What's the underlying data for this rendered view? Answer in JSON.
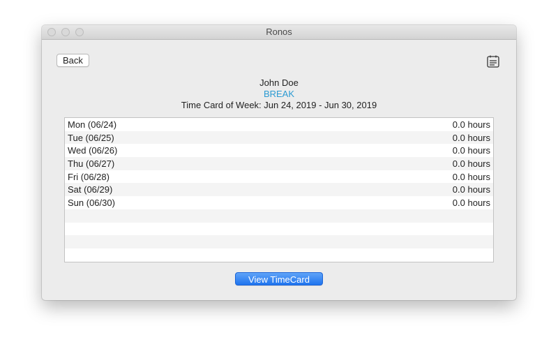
{
  "window": {
    "title": "Ronos"
  },
  "toolbar": {
    "back_label": "Back",
    "clipboard_icon": "clipboard-list-icon"
  },
  "header": {
    "employee_name": "John Doe",
    "status": "BREAK",
    "week_label": "Time Card of Week: Jun 24, 2019 - Jun 30, 2019"
  },
  "timecard": {
    "rows": [
      {
        "day": "Mon (06/24)",
        "hours": "0.0 hours"
      },
      {
        "day": "Tue (06/25)",
        "hours": "0.0 hours"
      },
      {
        "day": "Wed (06/26)",
        "hours": "0.0 hours"
      },
      {
        "day": "Thu (06/27)",
        "hours": "0.0 hours"
      },
      {
        "day": "Fri (06/28)",
        "hours": "0.0 hours"
      },
      {
        "day": "Sat (06/29)",
        "hours": "0.0 hours"
      },
      {
        "day": "Sun (06/30)",
        "hours": "0.0 hours"
      }
    ]
  },
  "actions": {
    "view_timecard_label": "View TimeCard"
  },
  "colors": {
    "accent": "#2b9ad2",
    "primary_button": "#1f74ee"
  }
}
